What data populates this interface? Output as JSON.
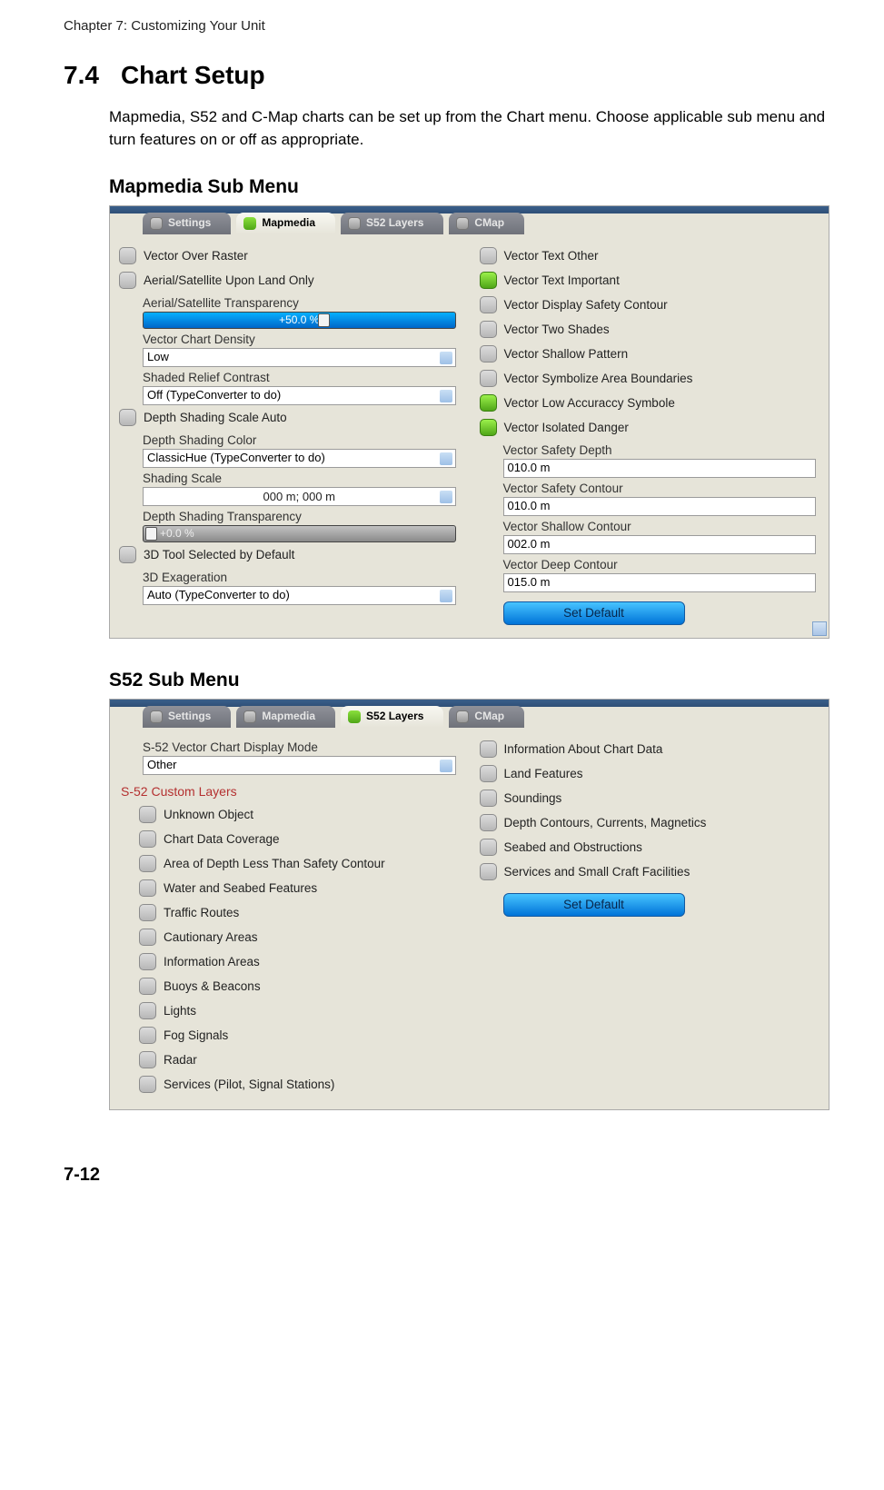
{
  "chapter": "Chapter 7: Customizing Your Unit",
  "section_number": "7.4",
  "section_title": "Chart Setup",
  "intro": "Mapmedia, S52 and C-Map charts can be set up from the Chart menu. Choose applicable sub menu and turn features on or off as appropriate.",
  "sub1_title": "Mapmedia Sub Menu",
  "sub2_title": "S52 Sub Menu",
  "page_num": "7-12",
  "mapmedia": {
    "tabs": {
      "settings": "Settings",
      "mapmedia": "Mapmedia",
      "s52": "S52 Layers",
      "cmap": "CMap"
    },
    "left": {
      "vector_over_raster": "Vector Over Raster",
      "aerial_land_only": "Aerial/Satellite Upon Land Only",
      "aerial_trans_label": "Aerial/Satellite Transparency",
      "aerial_trans_value": "+50.0 %",
      "density_label": "Vector Chart Density",
      "density_value": "Low",
      "relief_label": "Shaded Relief Contrast",
      "relief_value": "Off (TypeConverter to do)",
      "depth_auto": "Depth Shading Scale Auto",
      "depth_color_label": "Depth Shading Color",
      "depth_color_value": "ClassicHue (TypeConverter to do)",
      "shading_scale_label": "Shading Scale",
      "shading_scale_value": "000 m; 000 m",
      "depth_trans_label": "Depth Shading Transparency",
      "depth_trans_value": "+0.0 %",
      "tool3d": "3D Tool Selected by Default",
      "exag_label": "3D Exageration",
      "exag_value": "Auto (TypeConverter to do)"
    },
    "right": {
      "text_other": "Vector Text Other",
      "text_important": "Vector Text Important",
      "safety_contour_disp": "Vector Display Safety Contour",
      "two_shades": "Vector Two Shades",
      "shallow_pattern": "Vector Shallow Pattern",
      "symbolize_bound": "Vector Symbolize Area Boundaries",
      "low_accuracy": "Vector Low Accuraccy Symbole",
      "isolated_danger": "Vector Isolated Danger",
      "safety_depth_label": "Vector Safety Depth",
      "safety_depth_value": "010.0 m",
      "safety_contour_label": "Vector Safety Contour",
      "safety_contour_value": "010.0 m",
      "shallow_contour_label": "Vector Shallow Contour",
      "shallow_contour_value": "002.0 m",
      "deep_contour_label": "Vector Deep Contour",
      "deep_contour_value": "015.0 m",
      "set_default": "Set Default"
    }
  },
  "s52": {
    "tabs": {
      "settings": "Settings",
      "mapmedia": "Mapmedia",
      "s52": "S52 Layers",
      "cmap": "CMap"
    },
    "mode_label": "S-52 Vector Chart Display Mode",
    "mode_value": "Other",
    "custom_layers_title": "S-52 Custom Layers",
    "left_items": [
      "Unknown Object",
      "Chart Data Coverage",
      "Area of Depth Less Than Safety Contour",
      "Water and Seabed Features",
      "Traffic Routes",
      "Cautionary Areas",
      "Information Areas",
      "Buoys & Beacons",
      "Lights",
      "Fog Signals",
      "Radar",
      "Services (Pilot, Signal Stations)"
    ],
    "right_items": [
      "Information About Chart Data",
      "Land Features",
      "Soundings",
      "Depth Contours, Currents, Magnetics",
      "Seabed and Obstructions",
      "Services and Small Craft Facilities"
    ],
    "set_default": "Set Default"
  }
}
